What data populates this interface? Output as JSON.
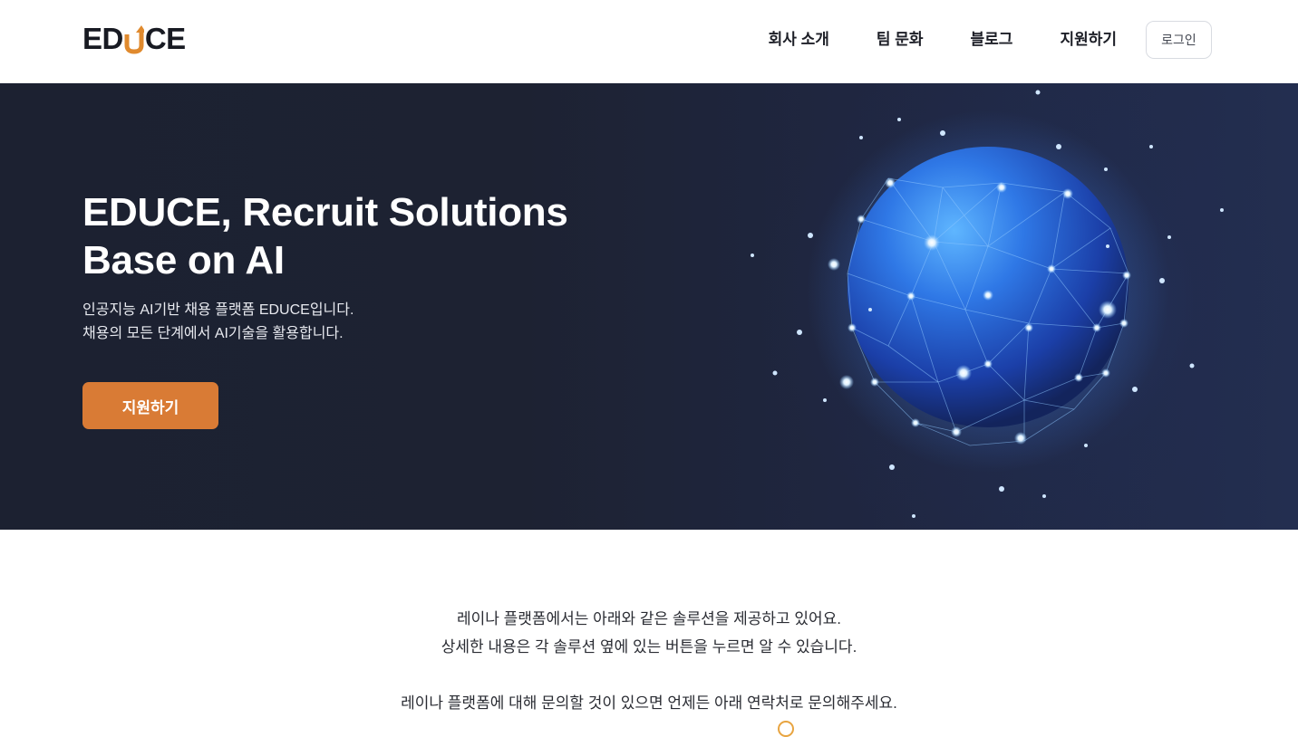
{
  "header": {
    "logo": {
      "left": "ED",
      "right": "CE",
      "accent_color": "#E08A2E"
    },
    "nav": [
      {
        "label": "회사 소개"
      },
      {
        "label": "팀 문화"
      },
      {
        "label": "블로그"
      },
      {
        "label": "지원하기"
      }
    ],
    "login_label": "로그인"
  },
  "hero": {
    "title_line1": "EDUCE, Recruit Solutions",
    "title_line2": "Base on AI",
    "subtitle_line1": "인공지능 AI기반 채용 플랫폼 EDUCE입니다.",
    "subtitle_line2": "채용의 모든 단계에서 AI기술을 활용합니다.",
    "cta_label": "지원하기",
    "cta_color": "#D97B35",
    "image_icon": "network-globe-icon"
  },
  "intro": {
    "line1": "레이나 플랫폼에서는 아래와 같은 솔루션을 제공하고 있어요.",
    "line2": "상세한 내용은 각 솔루션 옆에 있는 버튼을 누르면 알 수 있습니다.",
    "line3": "레이나 플랫폼에 대해 문의할 것이 있으면 언제든 아래 연락처로 문의해주세요."
  }
}
